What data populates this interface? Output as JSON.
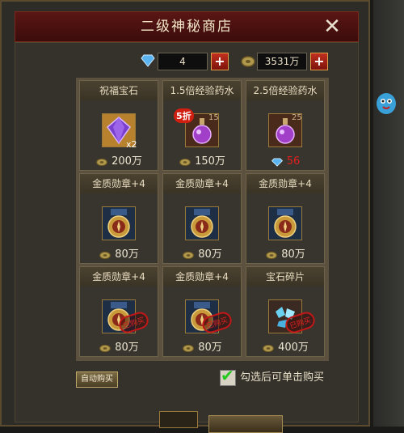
{
  "title": "二级神秘商店",
  "currency": {
    "diamond": "4",
    "coin": "3531万"
  },
  "items": [
    {
      "name": "祝福宝石",
      "price": "200万",
      "price_type": "coin",
      "icon": "purple-gem-icon",
      "qty": "x2"
    },
    {
      "name": "1.5倍经验药水",
      "price": "150万",
      "price_type": "coin",
      "icon": "purple-potion-icon",
      "badge": "5折",
      "count": "15"
    },
    {
      "name": "2.5倍经验药水",
      "price": "56",
      "price_type": "diamond",
      "icon": "purple-potion-icon",
      "count": "25"
    },
    {
      "name": "金质勋章+4",
      "price": "80万",
      "price_type": "coin",
      "icon": "medal-icon"
    },
    {
      "name": "金质勋章+4",
      "price": "80万",
      "price_type": "coin",
      "icon": "medal-icon"
    },
    {
      "name": "金质勋章+4",
      "price": "80万",
      "price_type": "coin",
      "icon": "medal-icon"
    },
    {
      "name": "金质勋章+4",
      "price": "80万",
      "price_type": "coin",
      "icon": "medal-icon",
      "stamp": "已购买"
    },
    {
      "name": "金质勋章+4",
      "price": "80万",
      "price_type": "coin",
      "icon": "medal-icon",
      "stamp": "已购买"
    },
    {
      "name": "宝石碎片",
      "price": "400万",
      "price_type": "coin",
      "icon": "gem-shards-icon",
      "stamp": "已购买"
    }
  ],
  "auto_buy_label": "自动购买",
  "checkbox_label": "勾选后可单击购买",
  "colors": {
    "price_diamond": "#e02020",
    "title_bg": "#4a1010",
    "check": "#25c820"
  }
}
